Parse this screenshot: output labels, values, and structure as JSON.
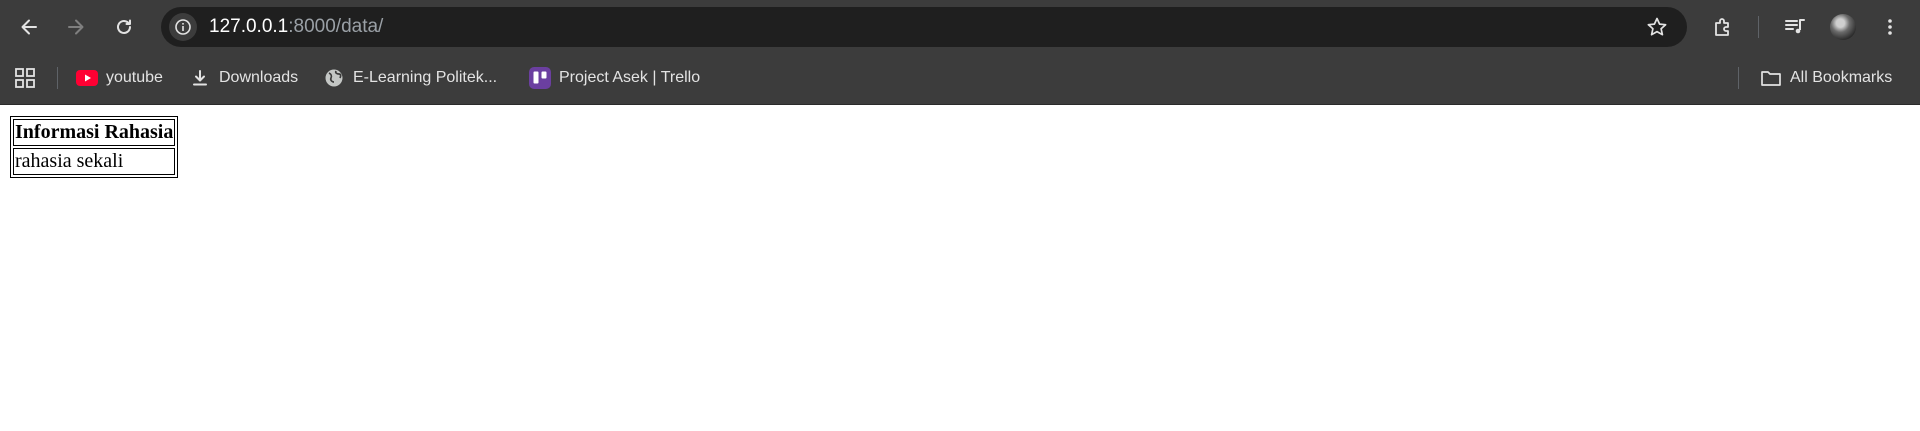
{
  "browser": {
    "url": {
      "host": "127.0.0.1",
      "rest": ":8000/data/"
    }
  },
  "bookmarks": [
    {
      "label": "youtube",
      "icon": "youtube-icon"
    },
    {
      "label": "Downloads",
      "icon": "download-icon"
    },
    {
      "label": "E-Learning Politek...",
      "icon": "globe-icon"
    },
    {
      "label": "Project Asek | Trello",
      "icon": "trello-icon"
    }
  ],
  "all_bookmarks": "All Bookmarks",
  "page": {
    "table_header": "Informasi Rahasia",
    "table_value": "rahasia sekali"
  },
  "colors": {
    "toolbar_bg": "#3c3c3c",
    "omnibox_bg": "#1f1f1f",
    "youtube_red": "#ff0033",
    "trello_purple": "#6b3fa0"
  }
}
